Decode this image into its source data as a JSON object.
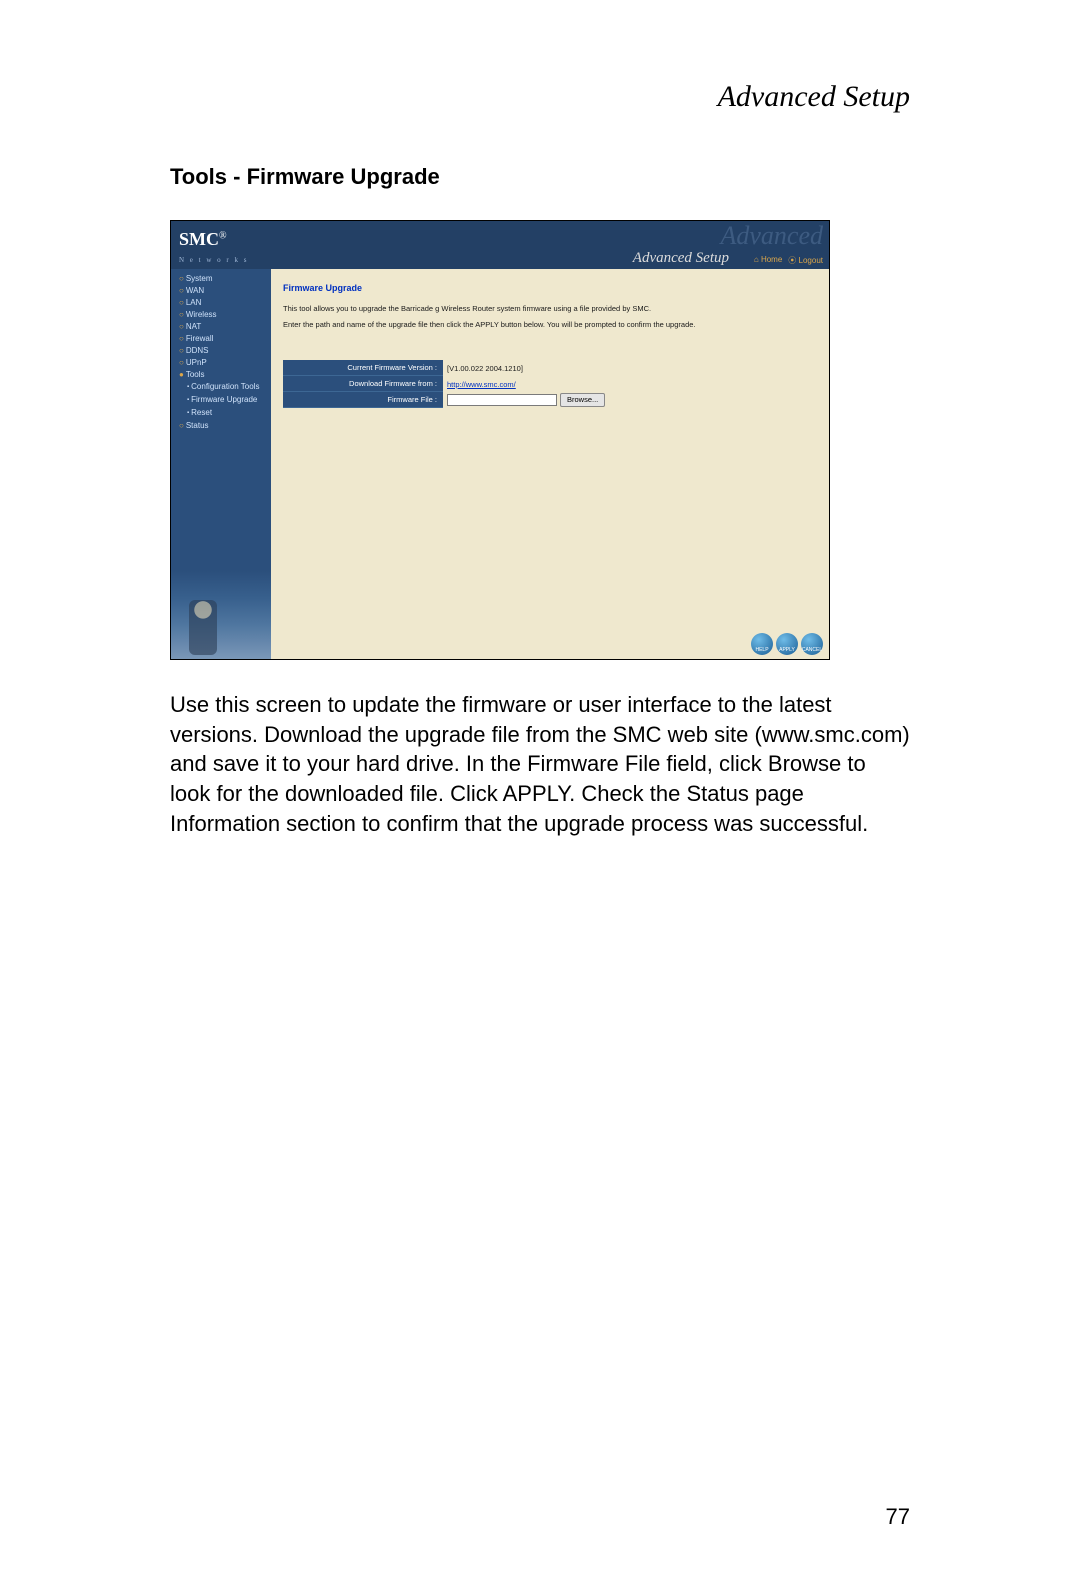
{
  "page": {
    "header": "Advanced Setup",
    "section_heading": "Tools - Firmware Upgrade",
    "body_text": "Use this screen to update the firmware or user interface to the latest versions. Download the upgrade file from the SMC web site (www.smc.com) and save it to your hard drive. In the Firmware File field, click Browse to look for the downloaded file. Click APPLY. Check the Status page Information section to confirm that the upgrade process was successful.",
    "page_number": "77"
  },
  "screenshot": {
    "logo_brand": "SMC",
    "logo_sub": "N e t w o r k s",
    "ghost_text": "Advanced",
    "title": "Advanced Setup",
    "home_link": "Home",
    "logout_link": "Logout",
    "sidebar": {
      "system": "System",
      "wan": "WAN",
      "lan": "LAN",
      "wireless": "Wireless",
      "nat": "NAT",
      "firewall": "Firewall",
      "ddns": "DDNS",
      "upnp": "UPnP",
      "tools": "Tools",
      "tools_sub": {
        "config": "Configuration Tools",
        "firmware": "Firmware Upgrade",
        "reset": "Reset"
      },
      "status": "Status"
    },
    "main": {
      "title": "Firmware Upgrade",
      "desc1": "This tool allows you to upgrade the Barricade g Wireless Router system firmware using a file provided by SMC.",
      "desc2": "Enter the path and name of the upgrade file then click the APPLY button below. You will be prompted to confirm the upgrade.",
      "row_version_label": "Current Firmware Version :",
      "row_version_value": "[V1.00.022 2004.1210]",
      "row_download_label": "Download Firmware from :",
      "row_download_value": "http://www.smc.com/",
      "row_file_label": "Firmware File :",
      "row_file_value": "",
      "browse_label": "Browse...",
      "btn_help": "HELP",
      "btn_apply": "APPLY",
      "btn_cancel": "CANCEL"
    }
  }
}
